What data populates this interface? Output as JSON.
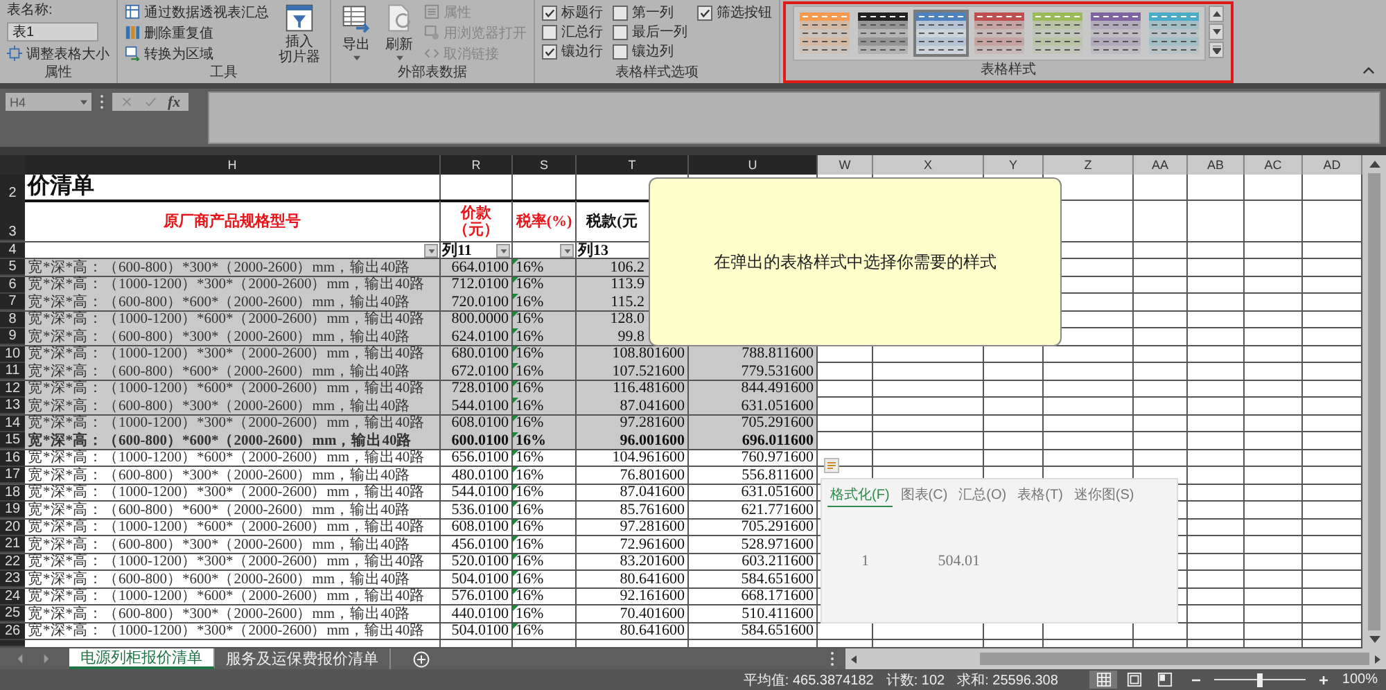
{
  "ribbon": {
    "properties_group": {
      "label": "属性",
      "table_name_label": "表名称:",
      "table_name": "表1",
      "resize_button": "调整表格大小"
    },
    "tools_group": {
      "label": "工具",
      "buttons": [
        {
          "kind": "pivot",
          "label": "通过数据透视表汇总"
        },
        {
          "kind": "dedupe",
          "label": "删除重复值"
        },
        {
          "kind": "convert",
          "label": "转换为区域"
        }
      ],
      "slicer_button": [
        "插入",
        "切片器"
      ]
    },
    "external_data_group": {
      "label": "外部表数据",
      "big_buttons": [
        {
          "kind": "export",
          "label": "导出"
        },
        {
          "kind": "refresh",
          "label": "刷新"
        }
      ],
      "small_buttons": [
        {
          "kind": "properties",
          "label": "属性",
          "disabled": true
        },
        {
          "kind": "browser",
          "label": "用浏览器打开",
          "disabled": true
        },
        {
          "kind": "unlink",
          "label": "取消链接",
          "disabled": true
        }
      ]
    },
    "style_options_group": {
      "label": "表格样式选项",
      "options": [
        {
          "label": "标题行",
          "checked": true
        },
        {
          "label": "汇总行",
          "checked": false
        },
        {
          "label": "镶边行",
          "checked": true
        },
        {
          "label": "第一列",
          "checked": false
        },
        {
          "label": "最后一列",
          "checked": false
        },
        {
          "label": "镶边列",
          "checked": false
        },
        {
          "label": "筛选按钮",
          "checked": true
        }
      ]
    },
    "styles_group": {
      "label": "表格样式",
      "styles": [
        {
          "color": "#f59a4f",
          "selected": false
        },
        {
          "color": "#222222",
          "selected": false
        },
        {
          "color": "#4f81bd",
          "selected": true
        },
        {
          "color": "#c0504d",
          "selected": false
        },
        {
          "color": "#9bbb59",
          "selected": false
        },
        {
          "color": "#8064a2",
          "selected": false
        },
        {
          "color": "#4bacc6",
          "selected": false
        }
      ]
    }
  },
  "formula_bar": {
    "name_box": "H4",
    "function_button": "fx"
  },
  "sheet": {
    "columns": [
      {
        "label": "H",
        "selected": true
      },
      {
        "label": "R",
        "selected": true
      },
      {
        "label": "S",
        "selected": true
      },
      {
        "label": "T",
        "selected": true
      },
      {
        "label": "U",
        "selected": true
      },
      {
        "label": "W",
        "selected": false
      },
      {
        "label": "X",
        "selected": false
      },
      {
        "label": "Y",
        "selected": false
      },
      {
        "label": "Z",
        "selected": false
      },
      {
        "label": "AA",
        "selected": false
      },
      {
        "label": "AB",
        "selected": false
      },
      {
        "label": "AC",
        "selected": false
      },
      {
        "label": "AD",
        "selected": false
      }
    ],
    "rows": [
      {
        "number": "2",
        "kind": "title",
        "cells": [
          "价清单"
        ]
      },
      {
        "number": "3",
        "kind": "header",
        "cells": [
          "原厂商产品规格型号",
          "价款（元）",
          "税率(%)",
          "税款(元"
        ]
      },
      {
        "number": "4",
        "kind": "filter",
        "cells": [
          {
            "dropdown": true
          },
          {
            "text": "列11",
            "dropdown": true
          },
          {
            "dropdown": true
          },
          {
            "text": "列13"
          }
        ]
      },
      {
        "number": "5",
        "kind": "data",
        "selected": true,
        "bold": false,
        "cells": [
          "宽*深*高：（600-800）*300*（2000-2600）mm，输出40路",
          "664.0100",
          "16%",
          "106.2"
        ]
      },
      {
        "number": "6",
        "kind": "data",
        "selected": true,
        "bold": false,
        "cells": [
          "宽*深*高：（1000-1200）*300*（2000-2600）mm，输出40路",
          "712.0100",
          "16%",
          "113.9"
        ]
      },
      {
        "number": "7",
        "kind": "data",
        "selected": true,
        "bold": false,
        "cells": [
          "宽*深*高：（600-800）*600*（2000-2600）mm，输出40路",
          "720.0100",
          "16%",
          "115.2"
        ]
      },
      {
        "number": "8",
        "kind": "data",
        "selected": true,
        "bold": false,
        "cells": [
          "宽*深*高：（1000-1200）*600*（2000-2600）mm，输出40路",
          "800.0000",
          "16%",
          "128.0"
        ]
      },
      {
        "number": "9",
        "kind": "data",
        "selected": true,
        "bold": false,
        "cells": [
          "宽*深*高：（600-800）*300*（2000-2600）mm，输出40路",
          "624.0100",
          "16%",
          "99.8"
        ]
      },
      {
        "number": "10",
        "kind": "data",
        "selected": true,
        "bold": false,
        "cells": [
          "宽*深*高：（1000-1200）*300*（2000-2600）mm，输出40路",
          "680.0100",
          "16%",
          "108.801600",
          "788.811600"
        ]
      },
      {
        "number": "11",
        "kind": "data",
        "selected": true,
        "bold": false,
        "cells": [
          "宽*深*高：（600-800）*600*（2000-2600）mm，输出40路",
          "672.0100",
          "16%",
          "107.521600",
          "779.531600"
        ]
      },
      {
        "number": "12",
        "kind": "data",
        "selected": true,
        "bold": false,
        "cells": [
          "宽*深*高：（1000-1200）*600*（2000-2600）mm，输出40路",
          "728.0100",
          "16%",
          "116.481600",
          "844.491600"
        ]
      },
      {
        "number": "13",
        "kind": "data",
        "selected": true,
        "bold": false,
        "cells": [
          "宽*深*高：（600-800）*300*（2000-2600）mm，输出40路",
          "544.0100",
          "16%",
          "87.041600",
          "631.051600"
        ]
      },
      {
        "number": "14",
        "kind": "data",
        "selected": true,
        "bold": false,
        "cells": [
          "宽*深*高：（1000-1200）*300*（2000-2600）mm，输出40路",
          "608.0100",
          "16%",
          "97.281600",
          "705.291600"
        ]
      },
      {
        "number": "15",
        "kind": "data",
        "selected": true,
        "bold": true,
        "cells": [
          "宽*深*高：（600-800）*600*（2000-2600）mm，输出40路",
          "600.0100",
          "16%",
          "96.001600",
          "696.011600"
        ]
      },
      {
        "number": "16",
        "kind": "data",
        "selected": false,
        "bold": false,
        "cells": [
          "宽*深*高：（1000-1200）*600*（2000-2600）mm，输出40路",
          "656.0100",
          "16%",
          "104.961600",
          "760.971600"
        ]
      },
      {
        "number": "17",
        "kind": "data",
        "selected": false,
        "bold": false,
        "cells": [
          "宽*深*高：（600-800）*300*（2000-2600）mm，输出40路",
          "480.0100",
          "16%",
          "76.801600",
          "556.811600"
        ]
      },
      {
        "number": "18",
        "kind": "data",
        "selected": false,
        "bold": false,
        "cells": [
          "宽*深*高：（1000-1200）*300*（2000-2600）mm，输出40路",
          "544.0100",
          "16%",
          "87.041600",
          "631.051600"
        ]
      },
      {
        "number": "19",
        "kind": "data",
        "selected": false,
        "bold": false,
        "cells": [
          "宽*深*高：（600-800）*600*（2000-2600）mm，输出40路",
          "536.0100",
          "16%",
          "85.761600",
          "621.771600"
        ]
      },
      {
        "number": "20",
        "kind": "data",
        "selected": false,
        "bold": false,
        "cells": [
          "宽*深*高：（1000-1200）*600*（2000-2600）mm，输出40路",
          "608.0100",
          "16%",
          "97.281600",
          "705.291600"
        ]
      },
      {
        "number": "21",
        "kind": "data",
        "selected": false,
        "bold": false,
        "cells": [
          "宽*深*高：（600-800）*300*（2000-2600）mm，输出40路",
          "456.0100",
          "16%",
          "72.961600",
          "528.971600"
        ]
      },
      {
        "number": "22",
        "kind": "data",
        "selected": false,
        "bold": false,
        "cells": [
          "宽*深*高：（1000-1200）*300*（2000-2600）mm，输出40路",
          "520.0100",
          "16%",
          "83.201600",
          "603.211600"
        ]
      },
      {
        "number": "23",
        "kind": "data",
        "selected": false,
        "bold": false,
        "cells": [
          "宽*深*高：（600-800）*600*（2000-2600）mm，输出40路",
          "504.0100",
          "16%",
          "80.641600",
          "584.651600"
        ]
      },
      {
        "number": "24",
        "kind": "data",
        "selected": false,
        "bold": false,
        "cells": [
          "宽*深*高：（1000-1200）*600*（2000-2600）mm，输出40路",
          "576.0100",
          "16%",
          "92.161600",
          "668.171600"
        ]
      },
      {
        "number": "25",
        "kind": "data",
        "selected": false,
        "bold": false,
        "cells": [
          "宽*深*高：（600-800）*300*（2000-2600）mm，输出40路",
          "440.0100",
          "16%",
          "70.401600",
          "510.411600"
        ]
      },
      {
        "number": "26",
        "kind": "data",
        "selected": false,
        "bold": false,
        "cells": [
          "宽*深*高：（1000-1200）*300*（2000-2600）mm，输出40路",
          "504.0100",
          "16%",
          "80.641600",
          "584.651600"
        ]
      }
    ]
  },
  "callout": {
    "text": "在弹出的表格样式中选择你需要的样式"
  },
  "quick_analysis": {
    "tabs": [
      {
        "label": "格式化(F)",
        "selected": true
      },
      {
        "label": "图表(C)",
        "selected": false
      },
      {
        "label": "汇总(O)",
        "selected": false
      },
      {
        "label": "表格(T)",
        "selected": false
      },
      {
        "label": "迷你图(S)",
        "selected": false
      }
    ],
    "preview": [
      "1",
      "504.01"
    ]
  },
  "sheet_tabs": [
    {
      "label": "电源列柜报价清单",
      "selected": true
    },
    {
      "label": "服务及运保费报价清单",
      "selected": false
    }
  ],
  "status_bar": {
    "stats": [
      "平均值: 465.3874182",
      "计数: 102",
      "求和: 25596.308"
    ],
    "views": [
      {
        "kind": "normal",
        "selected": true
      },
      {
        "kind": "page_layout",
        "selected": false
      },
      {
        "kind": "page_break",
        "selected": false
      }
    ],
    "zoom": {
      "level": 0.5,
      "percent": "100%"
    }
  }
}
